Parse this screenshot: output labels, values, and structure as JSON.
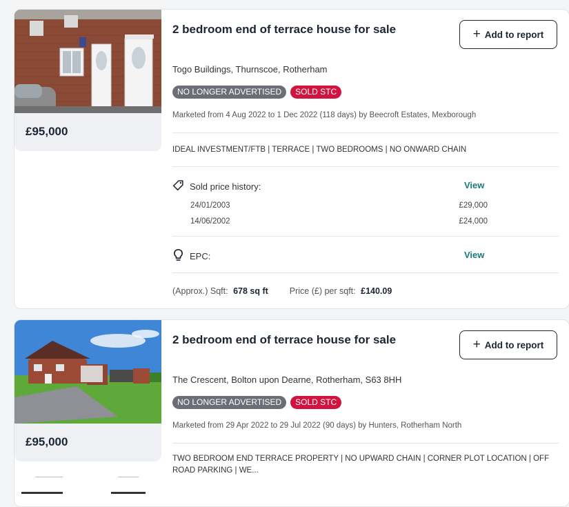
{
  "listings": [
    {
      "title": "2 bedroom end of terrace house for sale",
      "add_label": "Add to report",
      "address": "Togo Buildings, Thurnscoe, Rotherham",
      "badge_status": "NO LONGER ADVERTISED",
      "badge_sold": "SOLD STC",
      "marketed": "Marketed from 4 Aug 2022 to 1 Dec 2022 (118 days) by Beecroft Estates, Mexborough",
      "description": "IDEAL INVESTMENT/FTB | TERRACE | TWO BEDROOMS | NO ONWARD CHAIN",
      "price": "£95,000",
      "sold_history_label": "Sold price history:",
      "view_label": "View",
      "history": [
        {
          "date": "24/01/2003",
          "price": "£29,000"
        },
        {
          "date": "14/06/2002",
          "price": "£24,000"
        }
      ],
      "epc_label": "EPC:",
      "sqft_label": "(Approx.) Sqft:",
      "sqft_value": "678 sq ft",
      "ppsf_label": "Price (£) per sqft:",
      "ppsf_value": "£140.09"
    },
    {
      "title": "2 bedroom end of terrace house for sale",
      "add_label": "Add to report",
      "address": "The Crescent, Bolton upon Dearne, Rotherham, S63 8HH",
      "badge_status": "NO LONGER ADVERTISED",
      "badge_sold": "SOLD STC",
      "marketed": "Marketed from 29 Apr 2022 to 29 Jul 2022 (90 days) by Hunters, Rotherham North",
      "description": "TWO BEDROOM END TERRACE PROPERTY | NO UPWARD CHAIN | CORNER PLOT LOCATION | OFF ROAD PARKING | WE...",
      "price": "£95,000"
    }
  ],
  "colors": {
    "accent_link": "#177a7a",
    "badge_grey": "#6b6e77",
    "badge_red": "#d0143f",
    "text_dark": "#1d2433"
  },
  "icons": [
    "plus-icon",
    "price-tag-icon",
    "lightbulb-icon"
  ]
}
